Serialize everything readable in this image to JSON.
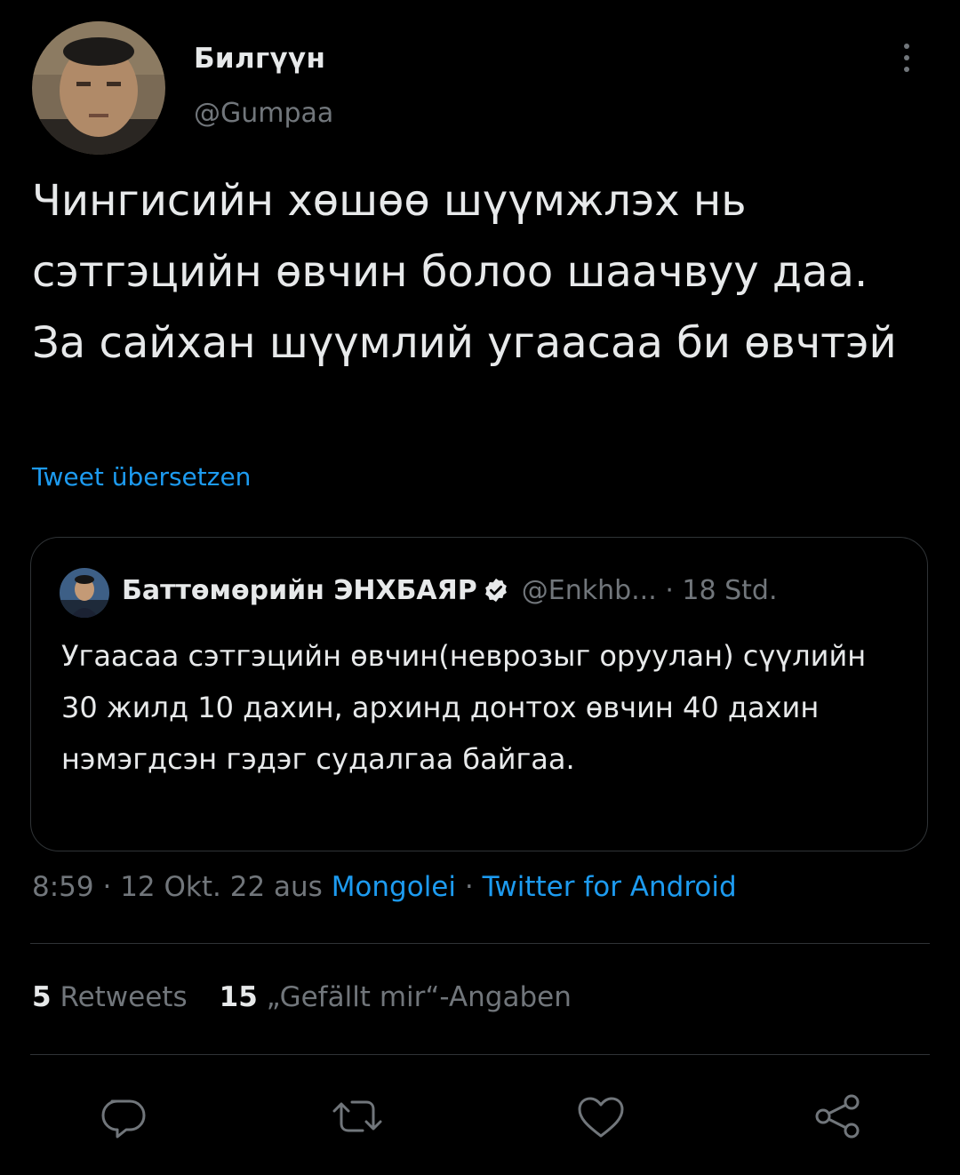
{
  "author": {
    "display_name": "Билгүүн",
    "handle": "@Gumpaa"
  },
  "tweet": {
    "text": "Чингисийн хөшөө шүүмжлэх нь сэтгэцийн өвчин болоо шаачвуу даа. За сайхан шүүмлий угаасаа би өвчтэй",
    "translate_label": "Tweet übersetzen"
  },
  "quoted_tweet": {
    "display_name": "Баттөмөрийн ЭНХБАЯР",
    "verified": true,
    "handle": "@Enkhb...",
    "separator": "·",
    "time": "18 Std.",
    "text": "Угаасаа сэтгэцийн өвчин(неврозыг оруулан) сүүлийн 30 жилд 10 дахин, архинд донтох өвчин 40 дахин нэмэгдсэн гэдэг судалгаа байгаа."
  },
  "meta": {
    "time": "8:59",
    "separator": "·",
    "date": "12 Okt. 22",
    "from_label": "aus",
    "location": "Mongolei",
    "client": "Twitter for Android"
  },
  "stats": {
    "retweets_count": "5",
    "retweets_label": "Retweets",
    "likes_count": "15",
    "likes_label": "„Gefällt mir“-Angaben"
  },
  "actions": [
    "reply-icon",
    "retweet-icon",
    "like-icon",
    "share-icon"
  ],
  "colors": {
    "background": "#000000",
    "text": "#e7e9ea",
    "secondary": "#71767b",
    "link": "#1d9bf0",
    "border": "#2f3336"
  }
}
